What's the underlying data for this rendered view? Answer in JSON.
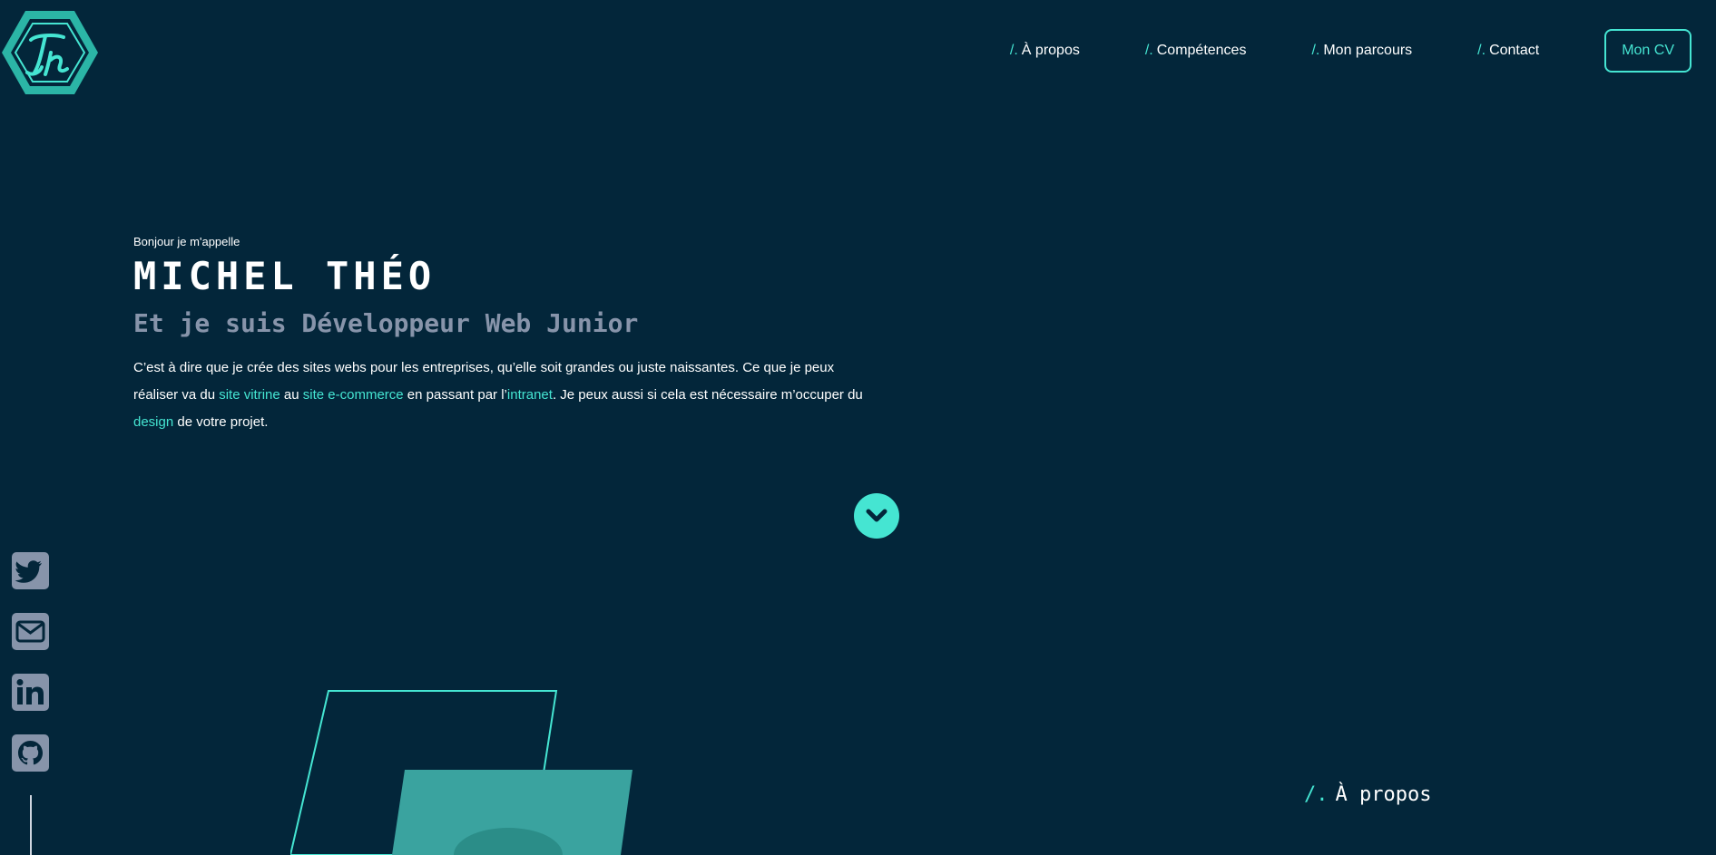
{
  "nav": {
    "slash": "/.",
    "items": [
      {
        "label": "À propos"
      },
      {
        "label": "Compétences"
      },
      {
        "label": "Mon parcours"
      },
      {
        "label": "Contact"
      }
    ],
    "cv_label": "Mon CV"
  },
  "hero": {
    "intro": "Bonjour je m'appelle",
    "name": "MICHEL THÉO",
    "subtitle": "Et je suis Développeur Web Junior",
    "desc": {
      "p1": "C’est à dire que je crée des sites webs pour les entreprises, qu’elle soit grandes ou juste naissantes. Ce que je peux réaliser va du ",
      "hl1": "site vitrine",
      "p2": " au ",
      "hl2": "site e-commerce",
      "p3": " en passant par l’",
      "hl3": "intranet",
      "p4": ". Je peux aussi si cela est nécessaire m’occuper du ",
      "hl4": "design",
      "p5": " de votre projet."
    }
  },
  "social": [
    "twitter-icon",
    "mail-icon",
    "linkedin-icon",
    "github-icon"
  ],
  "about": {
    "slash": "/.",
    "title": "À propos"
  },
  "colors": {
    "background": "#03263a",
    "accent": "#45e5d2",
    "muted": "#8794aa"
  }
}
